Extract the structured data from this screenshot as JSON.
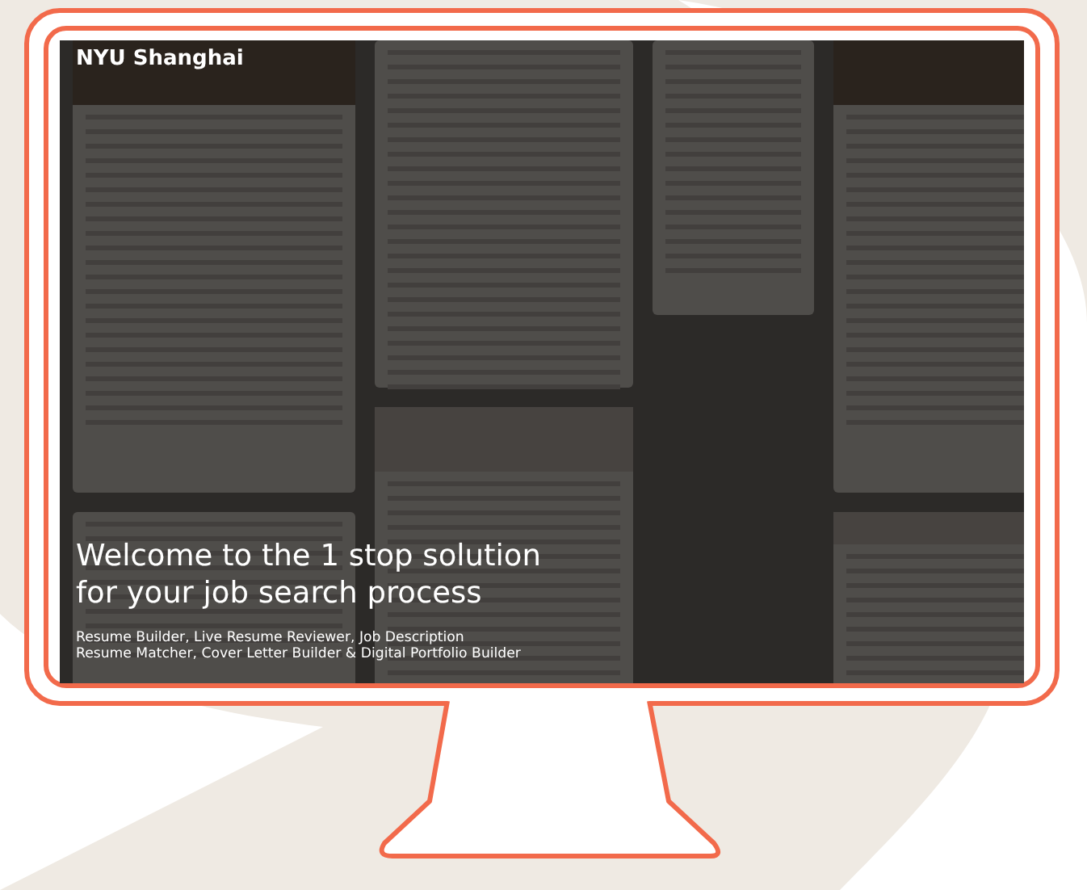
{
  "brand": "NYU Shanghai",
  "hero": {
    "heading": "Welcome to the 1 stop solution for your job search process",
    "subtitle_lines": [
      "Resume Builder, Live Resume Reviewer, Job Description",
      "Resume Matcher, Cover Letter Builder & Digital Portfolio Builder"
    ]
  }
}
